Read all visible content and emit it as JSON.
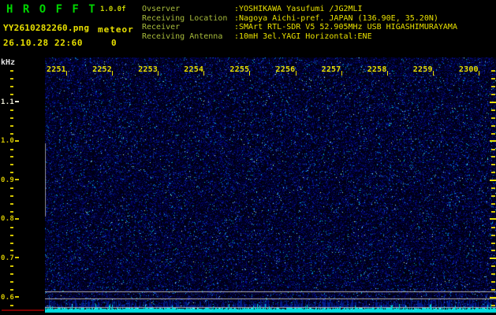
{
  "app": {
    "title": "H R O F F T",
    "version": "1.0.0f",
    "filename": "YY2610282260.png",
    "mode": "meteor",
    "count": "0",
    "timestamp": "26.10.28 22:60"
  },
  "station_info": {
    "rows": [
      {
        "label": "Ovserver",
        "value": ":YOSHIKAWA Yasufumi /JG2MLI"
      },
      {
        "label": "Receiving Location",
        "value": ":Nagoya Aichi-pref. JAPAN (136.90E, 35.20N)"
      },
      {
        "label": "Receiver",
        "value": ":SMArt RTL-SDR V5 52.905MHz USB HIGASHIMURAYAMA"
      },
      {
        "label": "Receiving Antenna",
        "value": ":10mH 3el.YAGI Horizontal:ENE"
      }
    ]
  },
  "chart": {
    "type": "spectrogram",
    "y_axis": {
      "unit": "kHz",
      "labels": [
        "1.1",
        "1.0",
        "0.9",
        "0.8",
        "0.7",
        "0.6"
      ]
    },
    "x_axis": {
      "labels": [
        "2251",
        "2252",
        "2253",
        "2254",
        "2255",
        "2256",
        "2257",
        "2258",
        "2259",
        "2300"
      ]
    },
    "colors": {
      "background": "#000000",
      "title_green": "#00d400",
      "version_green": "#c8d400",
      "label_green": "#a8bc3c",
      "value_yellow": "#e8e000",
      "axis_yellow": "#d2c400",
      "axis_white": "#e6e6d2",
      "unit_white": "#e6e6e6",
      "grid_gray": "#b4b4b4",
      "level_cyan": "#00dce0",
      "baseline_red": "#7c0000",
      "noise_base": "#000013"
    }
  }
}
